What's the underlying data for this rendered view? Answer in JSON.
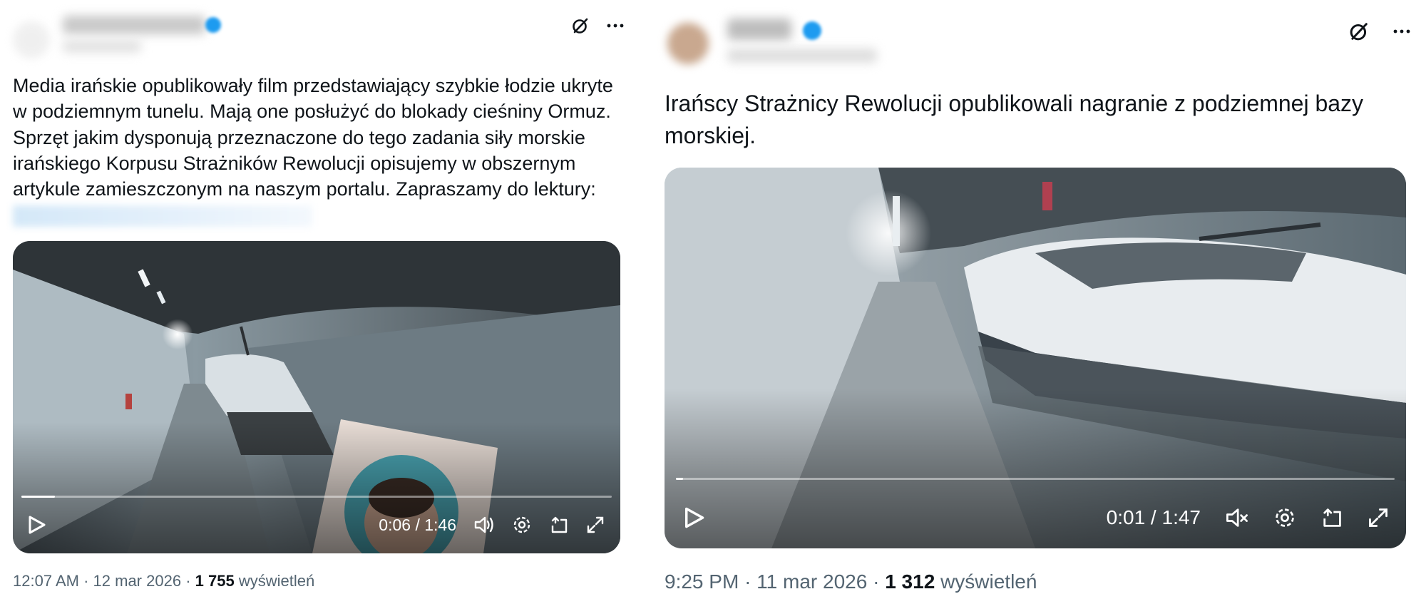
{
  "tweets": [
    {
      "author": {
        "display_name": "",
        "handle": "",
        "avatar": "blurred-avatar",
        "verified": true
      },
      "icons": [
        "grok-icon",
        "more-icon"
      ],
      "text": "Media irańskie opublikowały film przedstawiający szybkie łodzie ukryte\nw podziemnym tunelu. Mają one posłużyć do blokady cieśniny Ormuz.\nSprzęt jakim dysponują przeznaczone do tego zadania siły morskie\nirańskiego Korpusu Strażników Rewolucji opisujemy w obszernym\nartykule zamieszczonym na naszym portalu. Zapraszamy do lektury:",
      "link": "",
      "video": {
        "time": "0:06 / 1:46",
        "progress": 0.057,
        "muted": false,
        "controls": [
          "play-icon",
          "volume-icon",
          "settings-icon",
          "pip-icon",
          "fullscreen-icon"
        ]
      },
      "meta": {
        "time": "12:07 AM",
        "date": "12 mar 2026",
        "views_count": "1 755",
        "views_label": "wyświetleń",
        "sep": "·"
      }
    },
    {
      "author": {
        "display_name": "",
        "handle": "",
        "avatar": "blurred-avatar",
        "verified": true
      },
      "icons": [
        "grok-icon",
        "more-icon"
      ],
      "text": "Irańscy Strażnicy Rewolucji opublikowali nagranie z podziemnej bazy\nmorskiej.",
      "video": {
        "time": "0:01 / 1:47",
        "progress": 0.01,
        "muted": true,
        "controls": [
          "play-icon",
          "muted-icon",
          "settings-icon",
          "pip-icon",
          "fullscreen-icon"
        ]
      },
      "meta": {
        "time": "9:25 PM",
        "date": "11 mar 2026",
        "views_count": "1 312",
        "views_label": "wyświetleń",
        "sep": "·"
      }
    }
  ],
  "colors": {
    "text": "#0f1419",
    "secondary": "#536471",
    "verified": "#1d9bf0",
    "background": "#ffffff"
  }
}
